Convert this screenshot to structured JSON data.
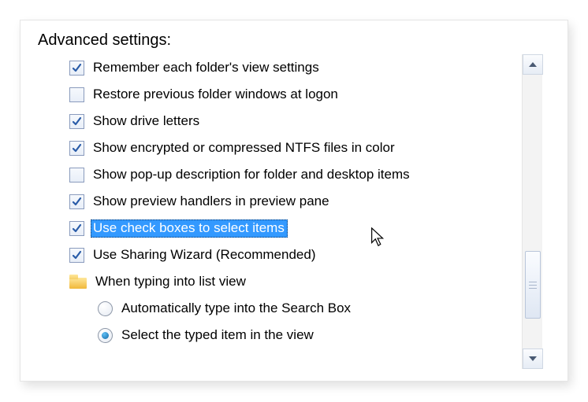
{
  "title": "Advanced settings:",
  "items": [
    {
      "kind": "check",
      "checked": true,
      "label": "Remember each folder's view settings"
    },
    {
      "kind": "check",
      "checked": false,
      "label": "Restore previous folder windows at logon"
    },
    {
      "kind": "check",
      "checked": true,
      "label": "Show drive letters"
    },
    {
      "kind": "check",
      "checked": true,
      "label": "Show encrypted or compressed NTFS files in color"
    },
    {
      "kind": "check",
      "checked": false,
      "label": "Show pop-up description for folder and desktop items"
    },
    {
      "kind": "check",
      "checked": true,
      "label": "Show preview handlers in preview pane"
    },
    {
      "kind": "check",
      "checked": true,
      "label": "Use check boxes to select items",
      "selected": true
    },
    {
      "kind": "check",
      "checked": true,
      "label": "Use Sharing Wizard (Recommended)"
    },
    {
      "kind": "folder",
      "label": "When typing into list view"
    },
    {
      "kind": "radio",
      "checked": false,
      "indent": true,
      "label": "Automatically type into the Search Box"
    },
    {
      "kind": "radio",
      "checked": true,
      "indent": true,
      "label": "Select the typed item in the view"
    }
  ]
}
